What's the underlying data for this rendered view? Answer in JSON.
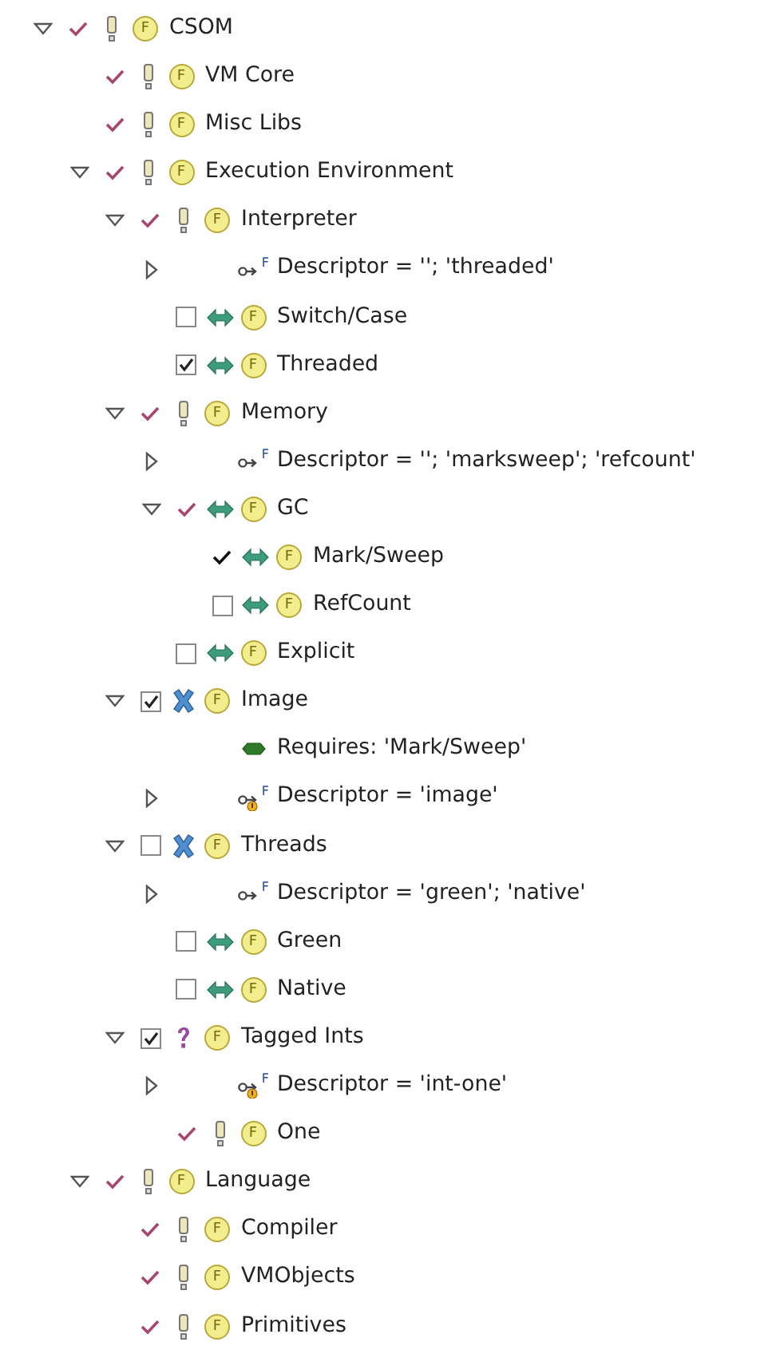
{
  "tree": [
    {
      "kind": "mandatory",
      "label": "CSOM",
      "badge": "F",
      "implied": true,
      "expanded": true,
      "children": [
        {
          "kind": "mandatory",
          "label": "VM Core",
          "badge": "F",
          "implied": true
        },
        {
          "kind": "mandatory",
          "label": "Misc Libs",
          "badge": "F",
          "implied": true
        },
        {
          "kind": "mandatory",
          "label": "Execution Environment",
          "badge": "F",
          "implied": true,
          "expanded": true,
          "children": [
            {
              "kind": "mandatory",
              "label": "Interpreter",
              "badge": "F",
              "implied": true,
              "expanded": true,
              "children": [
                {
                  "kind": "descriptor",
                  "label": "Descriptor = ''; 'threaded'",
                  "badge": "F",
                  "warning": false,
                  "expanded": false
                },
                {
                  "kind": "alternative",
                  "label": "Switch/Case",
                  "badge": "F",
                  "checked": false
                },
                {
                  "kind": "alternative",
                  "label": "Threaded",
                  "badge": "F",
                  "checked": true
                }
              ]
            },
            {
              "kind": "mandatory",
              "label": "Memory",
              "badge": "F",
              "implied": true,
              "expanded": true,
              "children": [
                {
                  "kind": "descriptor",
                  "label": "Descriptor = ''; 'marksweep'; 'refcount'",
                  "badge": "F",
                  "warning": false,
                  "expanded": false
                },
                {
                  "kind": "alternative",
                  "label": "GC",
                  "badge": "F",
                  "implied": true,
                  "expanded": true,
                  "children": [
                    {
                      "kind": "alternative",
                      "label": "Mark/Sweep",
                      "badge": "F",
                      "implied": false
                    },
                    {
                      "kind": "alternative",
                      "label": "RefCount",
                      "badge": "F",
                      "checked": false
                    }
                  ]
                },
                {
                  "kind": "alternative",
                  "label": "Explicit",
                  "badge": "F",
                  "checked": false
                }
              ]
            },
            {
              "kind": "or",
              "label": "Image",
              "badge": "F",
              "checked": true,
              "expanded": true,
              "children": [
                {
                  "kind": "constraint",
                  "label": "Requires: 'Mark/Sweep'"
                },
                {
                  "kind": "descriptor",
                  "label": "Descriptor = 'image'",
                  "badge": "F",
                  "warning": true,
                  "expanded": false
                }
              ]
            },
            {
              "kind": "or",
              "label": "Threads",
              "badge": "F",
              "checked": false,
              "expanded": true,
              "children": [
                {
                  "kind": "descriptor",
                  "label": "Descriptor = 'green'; 'native'",
                  "badge": "F",
                  "warning": false,
                  "expanded": false
                },
                {
                  "kind": "alternative",
                  "label": "Green",
                  "badge": "F",
                  "checked": false
                },
                {
                  "kind": "alternative",
                  "label": "Native",
                  "badge": "F",
                  "checked": false
                }
              ]
            },
            {
              "kind": "optional",
              "label": "Tagged Ints",
              "badge": "F",
              "checked": true,
              "expanded": true,
              "children": [
                {
                  "kind": "descriptor",
                  "label": "Descriptor = 'int-one'",
                  "badge": "F",
                  "warning": true,
                  "expanded": false
                },
                {
                  "kind": "mandatory",
                  "label": "One",
                  "badge": "F",
                  "implied": true
                }
              ]
            }
          ]
        },
        {
          "kind": "mandatory",
          "label": "Language",
          "badge": "F",
          "implied": true,
          "expanded": true,
          "children": [
            {
              "kind": "mandatory",
              "label": "Compiler",
              "badge": "F",
              "implied": true
            },
            {
              "kind": "mandatory",
              "label": "VMObjects",
              "badge": "F",
              "implied": true
            },
            {
              "kind": "mandatory",
              "label": "Primitives",
              "badge": "F",
              "implied": true
            }
          ]
        }
      ]
    }
  ]
}
